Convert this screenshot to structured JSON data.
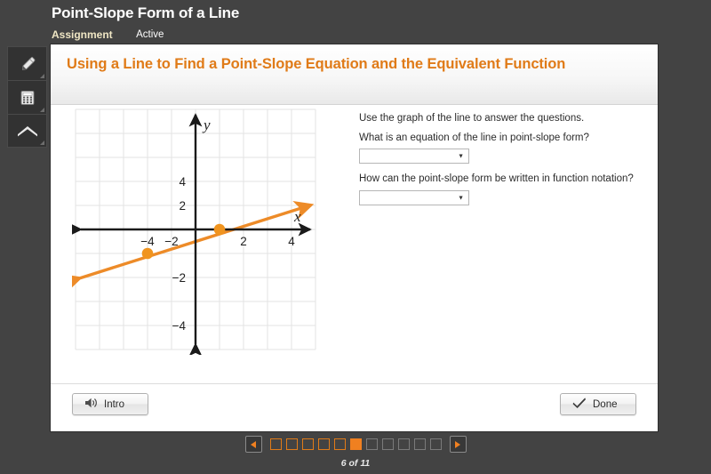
{
  "header": {
    "app_title": "Point-Slope Form of a Line",
    "tabs": [
      {
        "label": "Assignment",
        "state": "selected"
      },
      {
        "label": "Active",
        "state": "normal"
      }
    ]
  },
  "tool_rail": {
    "items": [
      {
        "name": "highlighter-tool",
        "icon": "pen-icon"
      },
      {
        "name": "calculator-tool",
        "icon": "calculator-icon"
      },
      {
        "name": "collapse-tool",
        "icon": "chevron-up-icon"
      }
    ]
  },
  "lesson": {
    "title": "Using a Line to Find a Point-Slope Equation and the Equivalent Function"
  },
  "questions": {
    "lead": "Use the graph of the line to answer the questions.",
    "q1_text": "What is an equation of the line in point-slope form?",
    "q1_value": "",
    "q2_text": "How can the point-slope form be written in function notation?",
    "q2_value": "",
    "dropdown_caret": "▼"
  },
  "footer": {
    "intro_label": "Intro",
    "done_label": "Done"
  },
  "pagination": {
    "prev_label": "◄",
    "next_label": "►",
    "total": 11,
    "current": 6,
    "counter_text": "6 of 11"
  },
  "colors": {
    "brand_orange": "#e07b18",
    "line_orange": "#ed8b28",
    "point_orange": "#f0941f",
    "window_bg": "#434343",
    "panel_bg": "#ffffff",
    "tab_selected": "#efe6c4"
  },
  "chart_data": {
    "type": "line",
    "title": "",
    "xlabel": "x",
    "ylabel": "y",
    "xlim": [
      -5,
      5
    ],
    "ylim": [
      -5,
      5
    ],
    "grid": true,
    "grid_step": 1,
    "xticks": [
      -4,
      -2,
      2,
      4
    ],
    "xtick_labels": [
      "−4",
      "−2",
      "2",
      "4"
    ],
    "yticks": [
      -4,
      -2,
      2,
      4
    ],
    "ytick_labels": [
      "−4",
      "−2",
      "2",
      "4"
    ],
    "legend": "none",
    "series": [
      {
        "name": "line",
        "type": "line",
        "color": "#ed8b28",
        "arrows": "both",
        "slope": 0.3333333,
        "intercept": -0.3333333,
        "equation": "y = (1/3)x - 1/3",
        "endpoints": [
          [
            -5.0,
            -2.0
          ],
          [
            5.0,
            1.5
          ]
        ],
        "marked_points": [
          {
            "x": 1,
            "y": 0,
            "color": "#f0941f"
          },
          {
            "x": -2,
            "y": -1,
            "color": "#f0941f"
          }
        ]
      }
    ]
  }
}
